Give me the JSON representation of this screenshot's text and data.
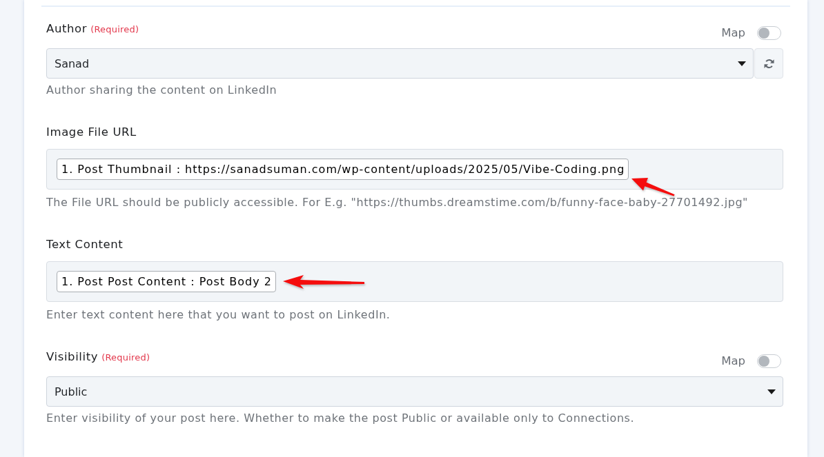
{
  "fields": [
    {
      "kind": "select",
      "label": "Author",
      "required_tag": "(Required)",
      "map": {
        "label": "Map",
        "on": false
      },
      "value": "Sanad",
      "refresh_button": true,
      "help": "Author sharing the content on LinkedIn"
    },
    {
      "kind": "token",
      "label": "Image File URL",
      "token": "1. Post Thumbnail : https://sanadsuman.com/wp-content/uploads/2025/05/Vibe-Coding.png",
      "annotation": {
        "kind": "diagonal"
      },
      "help": "The File URL should be publicly accessible. For E.g. \"https://thumbs.dreamstime.com/b/funny-face-baby-27701492.jpg\""
    },
    {
      "kind": "token",
      "label": "Text Content",
      "token": "1. Post Post Content : Post Body 2",
      "annotation": {
        "kind": "horizontal"
      },
      "help": "Enter text content here that you want to post on LinkedIn."
    },
    {
      "kind": "select",
      "label": "Visibility",
      "required_tag": "(Required)",
      "map": {
        "label": "Map",
        "on": false
      },
      "value": "Public",
      "help": "Enter visibility of your post here. Whether to make the post Public or available only to Connections."
    }
  ]
}
